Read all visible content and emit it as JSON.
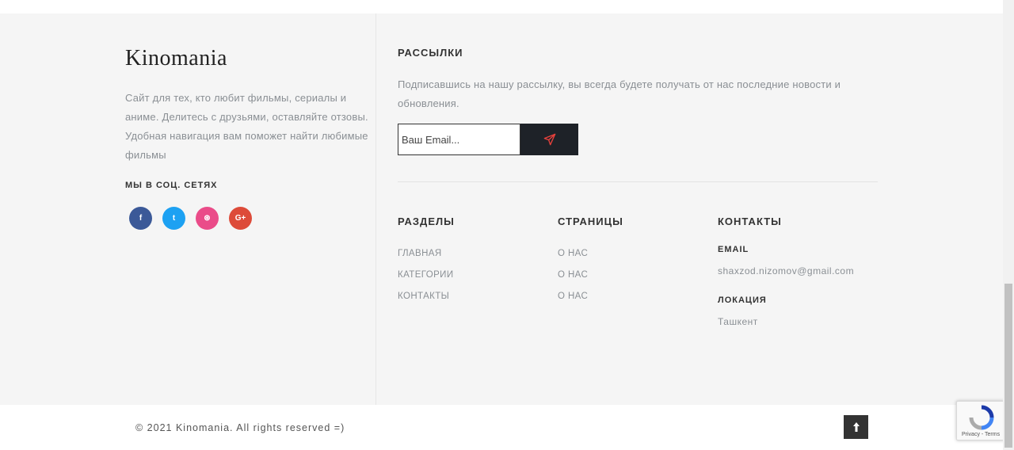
{
  "footer": {
    "brand": "Kinomania",
    "about": "Сайт для тех, кто любит фильмы, сериалы и аниме. Делитесь с друзьями, оставляйте отзовы. Удобная навигация вам поможет найти любимые фильмы",
    "social_title": "МЫ В СОЦ. СЕТЯХ",
    "social_icons": [
      {
        "name": "facebook-icon",
        "glyph": "f",
        "color": "#3b5998"
      },
      {
        "name": "twitter-icon",
        "glyph": "t",
        "color": "#1da1f2"
      },
      {
        "name": "dribbble-icon",
        "glyph": "⊛",
        "color": "#ea4c89"
      },
      {
        "name": "google-plus-icon",
        "glyph": "G+",
        "color": "#dd4b39"
      }
    ]
  },
  "newsletter": {
    "title": "РАССЫЛКИ",
    "text": "Подписавшись на нашу рассылку, вы всегда будете получать от нас последние новости и обновления.",
    "email_placeholder": "Ваш Email...",
    "send_icon": "paper-plane-icon"
  },
  "sections": {
    "title": "РАЗДЕЛЫ",
    "items": [
      "ГЛАВНАЯ",
      "КАТЕГОРИИ",
      "КОНТАКТЫ"
    ]
  },
  "pages": {
    "title": "СТРАНИЦЫ",
    "items": [
      "О НАС",
      "О НАС",
      "О НАС"
    ]
  },
  "contacts": {
    "title": "КОНТАКТЫ",
    "email_label": "EMAIL",
    "email_value": "shaxzod.nizomov@gmail.com",
    "location_label": "ЛОКАЦИЯ",
    "location_value": "Ташкент"
  },
  "bottom": {
    "copyright": "© 2021 Kinomania. All rights reserved =)",
    "to_top_icon": "arrow-up-icon",
    "recaptcha_label": "Privacy - Terms"
  }
}
